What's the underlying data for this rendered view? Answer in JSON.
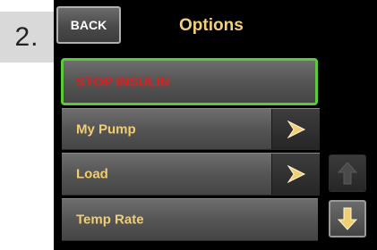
{
  "step": {
    "number": "2."
  },
  "header": {
    "back_label": "BACK",
    "title": "Options"
  },
  "menu": {
    "items": [
      {
        "label": "STOP INSULIN",
        "selected": true,
        "has_arrow": false
      },
      {
        "label": "My Pump",
        "has_arrow": true
      },
      {
        "label": "Load",
        "has_arrow": true
      },
      {
        "label": "Temp Rate",
        "has_arrow": false
      }
    ]
  },
  "scroll": {
    "up_icon": "up-arrow-icon",
    "down_icon": "down-arrow-icon"
  },
  "colors": {
    "label_text": "#f0cf73",
    "stop_text": "#e21b1b",
    "selected_border": "#5cc83c",
    "screen_bg": "#000000"
  }
}
